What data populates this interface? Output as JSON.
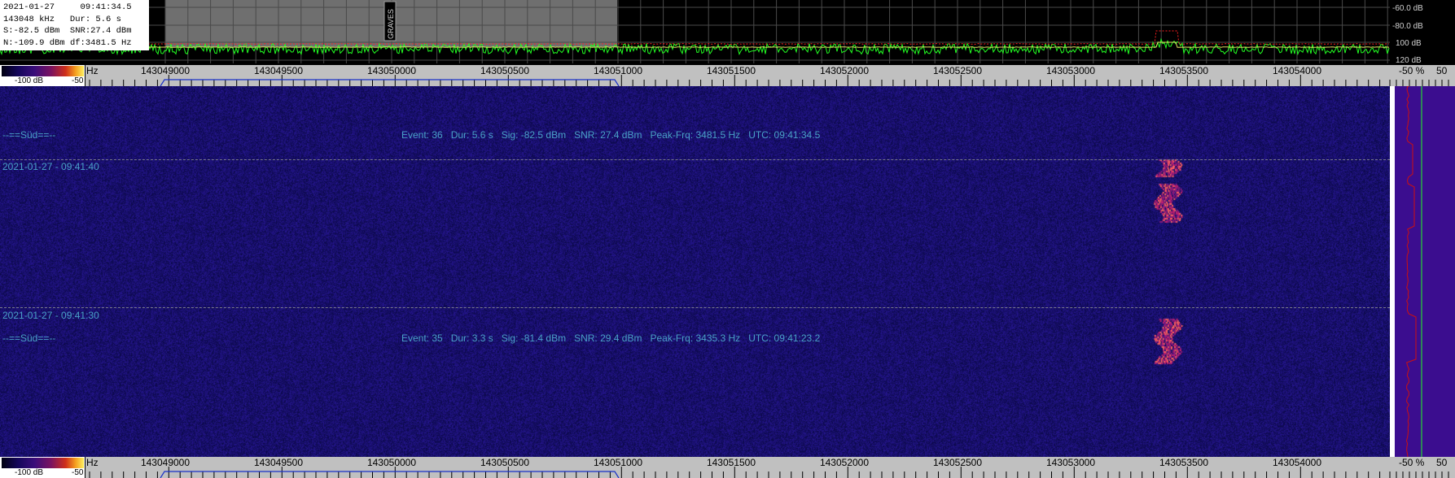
{
  "info_box": {
    "date": "2021-01-27",
    "time": "09:41:34.5",
    "freq": "143048 kHz",
    "dur": "Dur: 5.6 s",
    "signal": "S:-82.5 dBm",
    "snr": "SNR:27.4 dBm",
    "noise": "N:-109.9 dBm",
    "df": "df:3481.5 Hz"
  },
  "spectrum": {
    "db_labels": [
      "-60.0 dB",
      "-80.0 dB",
      "100 dB",
      "120 dB"
    ],
    "marker_label": "GRAVES"
  },
  "color_legend": {
    "min": "-100 dB",
    "max": "-50"
  },
  "freq_scale": {
    "unit_suffix": "Hz",
    "labels": [
      "143049000",
      "143049500",
      "143050000",
      "143050500",
      "143051000",
      "143051500",
      "143052000",
      "143052500",
      "143053000",
      "143053500",
      "143054000"
    ],
    "percent": "-50 %",
    "percent_max": "50"
  },
  "waterfall": {
    "events": [
      {
        "tag": "--==Süd==--",
        "text": "Event: 36   Dur: 5.6 s   Sig: -82.5 dBm   SNR: 27.4 dBm   Peak-Frq: 3481.5 Hz   UTC: 09:41:34.5"
      },
      {
        "tag": "--==Süd==--",
        "text": "Event: 35   Dur: 3.3 s   Sig: -81.4 dBm   SNR: 29.4 dBm   Peak-Frq: 3435.3 Hz   UTC: 09:41:23.2"
      }
    ],
    "timestamps": [
      "2021-01-27 - 09:41:40",
      "2021-01-27 - 09:41:30"
    ]
  },
  "colors": {
    "waterfall_bg": "#13105a",
    "annotation_text": "#4aa1c8",
    "spectrum_trace": "#22ff22",
    "threshold_line": "#ff2020",
    "marker_region": "#6f6f6f",
    "right_panel": "#3b0d8f"
  }
}
